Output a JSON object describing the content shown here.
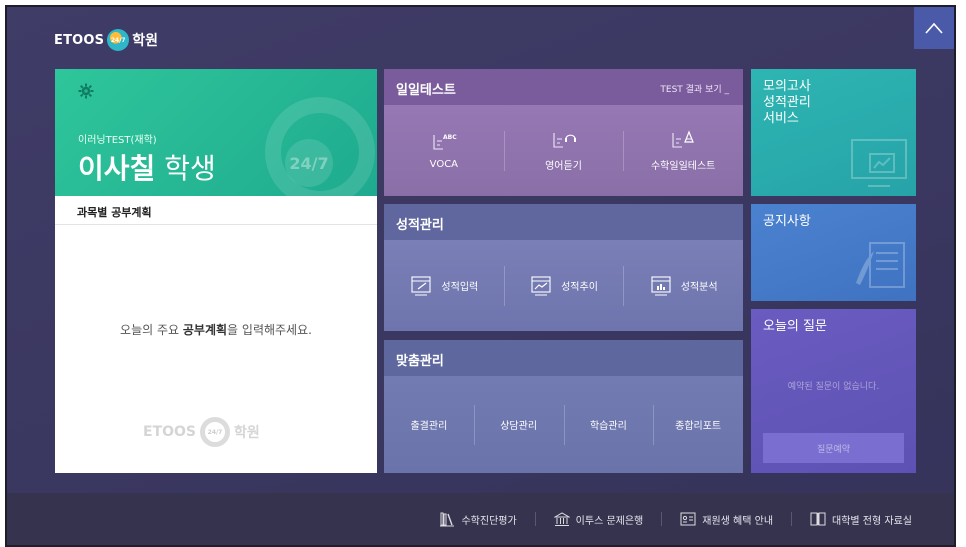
{
  "header": {
    "logo_etoos": "ETOOS",
    "logo_247": "24/7",
    "logo_hakwon": "학원"
  },
  "student": {
    "sub_label": "이러닝TEST(재학)",
    "name_bold": "이사칠",
    "name_suffix": "학생",
    "ring_label": "24/7",
    "plan_title": "과목별 공부계획",
    "plan_empty_pre": "오늘의 주요 ",
    "plan_empty_bold": "공부계획",
    "plan_empty_post": "을 입력해주세요.",
    "watermark_etoos": "ETOOS",
    "watermark_247": "24/7",
    "watermark_hakwon": "학원"
  },
  "daily_test": {
    "title": "일일테스트",
    "result_link": "TEST 결과 보기 _",
    "items": [
      {
        "label": "VOCA",
        "icon": "voca-icon"
      },
      {
        "label": "영어듣기",
        "icon": "listening-icon"
      },
      {
        "label": "수학일일테스트",
        "icon": "math-icon"
      }
    ]
  },
  "grade": {
    "title": "성적관리",
    "items": [
      {
        "label": "성적입력",
        "icon": "grade-input-icon"
      },
      {
        "label": "성적추이",
        "icon": "grade-trend-icon"
      },
      {
        "label": "성적분석",
        "icon": "grade-analysis-icon"
      }
    ]
  },
  "custom": {
    "title": "맞춤관리",
    "items": [
      {
        "label": "출결관리"
      },
      {
        "label": "상담관리"
      },
      {
        "label": "학습관리"
      },
      {
        "label": "종합리포트"
      }
    ]
  },
  "right": {
    "mock_title_1": "모의고사",
    "mock_title_2": "성적관리",
    "mock_title_3": "서비스",
    "notice_title": "공지사항",
    "question_title": "오늘의 질문",
    "question_empty": "예약된 질문이 없습니다.",
    "question_button": "질문예약"
  },
  "footer": {
    "items": [
      {
        "label": "수학진단평가",
        "icon": "books-icon"
      },
      {
        "label": "이투스 문제은행",
        "icon": "bank-icon"
      },
      {
        "label": "재원생 혜택 안내",
        "icon": "id-card-icon"
      },
      {
        "label": "대학별 전형 자료실",
        "icon": "book-open-icon"
      }
    ]
  },
  "colors": {
    "background": "#3c3a63",
    "student_green": "#24b392",
    "daily_test": "#8a6aa8",
    "grade": "#6e74ad",
    "custom": "#6a73aa",
    "mock": "#2aaeae",
    "notice": "#4579c8",
    "question": "#6357b9"
  }
}
